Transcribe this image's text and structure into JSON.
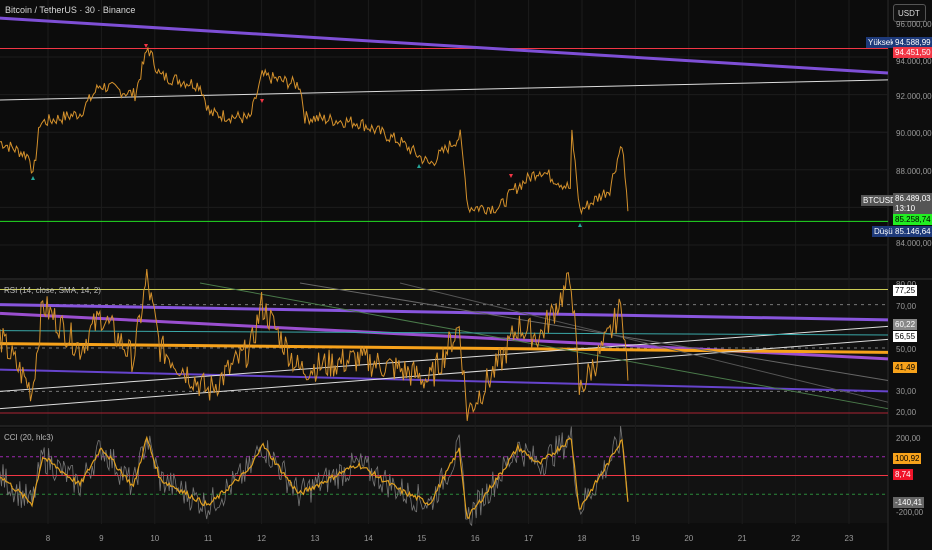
{
  "header": {
    "title": "Bitcoin / TetherUS · 30 · Binance",
    "currency": "USDT"
  },
  "price_axis": {
    "ticks": [
      "94.000,00",
      "92.000,00",
      "90.000,00",
      "88.000,00",
      "84.000,00"
    ],
    "high_label": "Yüksek",
    "high_value": "94.588,99",
    "red_line_value": "94.451,50",
    "symbol": "BTCUSDT",
    "last_price": "86.489,03",
    "countdown": "13:10",
    "green_line_value": "85.258,74",
    "low_label": "Düşük",
    "low_value": "85.146,64",
    "top_partial": "96.000,00"
  },
  "rsi": {
    "title": "RSI (14, close, SMA, 14, 2)",
    "ticks": [
      "80,00",
      "70,00",
      "50,00",
      "30,00",
      "20,00"
    ],
    "labels": [
      "77,25",
      "60,22",
      "56,55",
      "41,49"
    ]
  },
  "cci": {
    "title": "CCI (20, hlc3)",
    "ticks": [
      "200,00",
      "-200,00"
    ],
    "labels": [
      "100,92",
      "8,74",
      "-140,41"
    ]
  },
  "time_axis": [
    "8",
    "9",
    "10",
    "11",
    "12",
    "13",
    "14",
    "15",
    "16",
    "17",
    "18",
    "19",
    "20",
    "21",
    "22",
    "23"
  ],
  "colors": {
    "bg": "#0d0d0d",
    "price": "#d4912c",
    "purple": "#7e4fd6",
    "red": "#f23645",
    "green": "#22dd22",
    "blue": "#1e3a7a"
  },
  "chart_data": {
    "type": "line",
    "price": [
      [
        7.1,
        89500
      ],
      [
        7.66,
        88700
      ],
      [
        7.72,
        87600
      ],
      [
        7.85,
        90500
      ],
      [
        8.6,
        91000
      ],
      [
        8.97,
        92500
      ],
      [
        9.63,
        92000
      ],
      [
        9.87,
        94500
      ],
      [
        10.1,
        93000
      ],
      [
        10.85,
        92500
      ],
      [
        11.03,
        91000
      ],
      [
        11.78,
        90700
      ],
      [
        12.01,
        93000
      ],
      [
        12.72,
        92500
      ],
      [
        12.81,
        90800
      ],
      [
        13.84,
        90500
      ],
      [
        14.59,
        89500
      ],
      [
        15.15,
        88300
      ],
      [
        15.72,
        89800
      ],
      [
        15.87,
        86000
      ],
      [
        16.46,
        86000
      ],
      [
        16.75,
        87000
      ],
      [
        17.21,
        88000
      ],
      [
        17.78,
        87000
      ],
      [
        17.81,
        90000
      ],
      [
        17.96,
        85800
      ],
      [
        18.52,
        87000
      ],
      [
        18.75,
        89500
      ],
      [
        18.86,
        85800
      ]
    ],
    "trendlines": [
      {
        "color": "#7e4fd6",
        "from": [
          7.1,
          96070
        ],
        "to": [
          23.73,
          93150
        ]
      },
      {
        "color": "#dddddd",
        "from": [
          7.1,
          91710
        ],
        "to": [
          23.73,
          92780
        ]
      }
    ],
    "hlines": [
      {
        "value": 94451.5,
        "color": "#f23645"
      },
      {
        "value": 85258.74,
        "color": "#22dd22"
      }
    ],
    "rsi": [
      [
        7.1,
        55
      ],
      [
        7.7,
        30
      ],
      [
        7.9,
        70
      ],
      [
        8.6,
        50
      ],
      [
        9.0,
        65
      ],
      [
        9.6,
        45
      ],
      [
        9.85,
        82
      ],
      [
        10.1,
        50
      ],
      [
        11.0,
        30
      ],
      [
        11.8,
        50
      ],
      [
        12.0,
        70
      ],
      [
        12.7,
        40
      ],
      [
        13.8,
        45
      ],
      [
        14.6,
        40
      ],
      [
        15.15,
        35
      ],
      [
        15.7,
        60
      ],
      [
        15.85,
        20
      ],
      [
        16.5,
        45
      ],
      [
        16.8,
        60
      ],
      [
        17.2,
        55
      ],
      [
        17.8,
        82
      ],
      [
        17.95,
        30
      ],
      [
        18.5,
        55
      ],
      [
        18.75,
        70
      ],
      [
        18.86,
        35
      ]
    ],
    "cci": [
      [
        7.1,
        0
      ],
      [
        7.7,
        -150
      ],
      [
        7.9,
        100
      ],
      [
        8.6,
        -50
      ],
      [
        9.0,
        150
      ],
      [
        9.6,
        -60
      ],
      [
        9.85,
        200
      ],
      [
        10.1,
        -20
      ],
      [
        11.0,
        -160
      ],
      [
        11.8,
        40
      ],
      [
        12.0,
        170
      ],
      [
        12.7,
        -100
      ],
      [
        13.8,
        60
      ],
      [
        14.6,
        -80
      ],
      [
        15.15,
        -150
      ],
      [
        15.7,
        140
      ],
      [
        15.85,
        -230
      ],
      [
        16.5,
        20
      ],
      [
        16.8,
        150
      ],
      [
        17.2,
        60
      ],
      [
        17.8,
        200
      ],
      [
        17.95,
        -180
      ],
      [
        18.5,
        70
      ],
      [
        18.75,
        200
      ],
      [
        18.86,
        -140
      ]
    ]
  }
}
